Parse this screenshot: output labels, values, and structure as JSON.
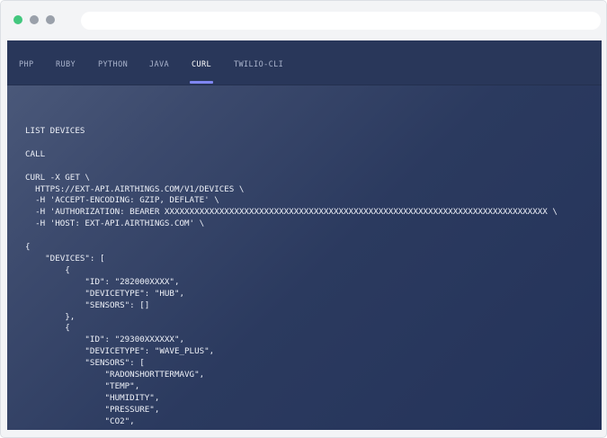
{
  "browser": {
    "dots": [
      "#43c77e",
      "#9aa0aa",
      "#9aa0aa"
    ]
  },
  "tabs": [
    {
      "label": "PHP",
      "active": false
    },
    {
      "label": "RUBY",
      "active": false
    },
    {
      "label": "PYTHON",
      "active": false
    },
    {
      "label": "JAVA",
      "active": false
    },
    {
      "label": "CURL",
      "active": true
    },
    {
      "label": "TWILIO-CLI",
      "active": false
    }
  ],
  "code": {
    "lines": [
      "LIST DEVICES",
      "",
      "CALL",
      "",
      "CURL -X GET \\",
      "  HTTPS://EXT-API.AIRTHINGS.COM/V1/DEVICES \\",
      "  -H 'ACCEPT-ENCODING: GZIP, DEFLATE' \\",
      "  -H 'AUTHORIZATION: BEARER XXXXXXXXXXXXXXXXXXXXXXXXXXXXXXXXXXXXXXXXXXXXXXXXXXXXXXXXXXXXXXXXXXXXXXXXXXXXX \\",
      "  -H 'HOST: EXT-API.AIRTHINGS.COM' \\",
      "",
      "{",
      "    \"DEVICES\": [",
      "        {",
      "            \"ID\": \"282000XXXX\",",
      "            \"DEVICETYPE\": \"HUB\",",
      "            \"SENSORS\": []",
      "        },",
      "        {",
      "            \"ID\": \"29300XXXXXX\",",
      "            \"DEVICETYPE\": \"WAVE_PLUS\",",
      "            \"SENSORS\": [",
      "                \"RADONSHORTTERMAVG\",",
      "                \"TEMP\",",
      "                \"HUMIDITY\",",
      "                \"PRESSURE\",",
      "                \"CO2\","
    ]
  }
}
